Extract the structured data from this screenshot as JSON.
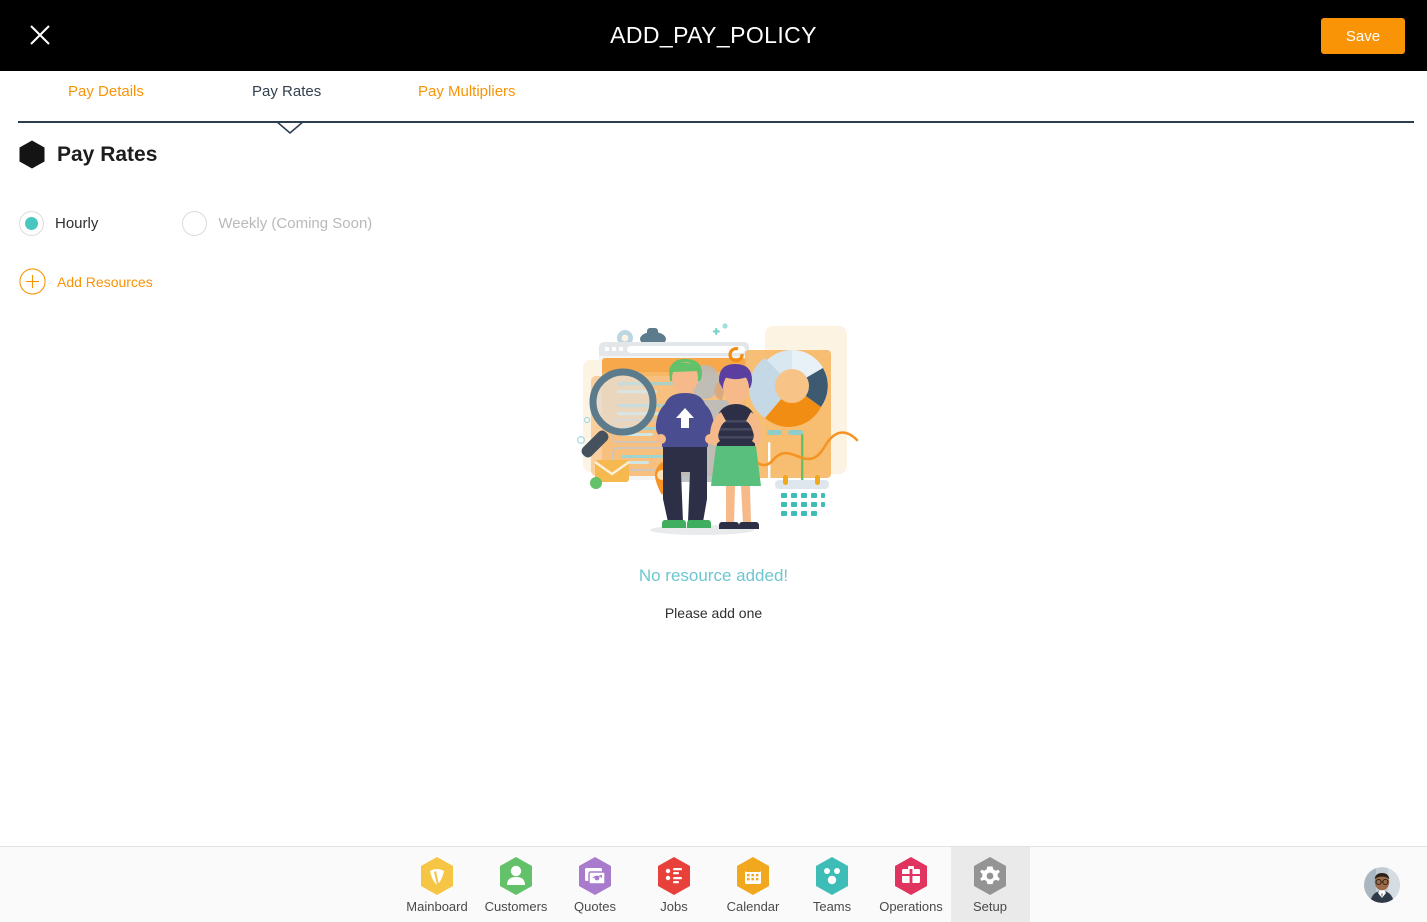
{
  "titlebar": {
    "title": "ADD_PAY_POLICY",
    "close_icon": "close-icon",
    "save_label": "Save",
    "save_color": "#f89406"
  },
  "tabs": [
    {
      "label": "Pay Details",
      "active": false
    },
    {
      "label": "Pay Rates",
      "active": true
    },
    {
      "label": "Pay Multipliers",
      "active": false
    }
  ],
  "section": {
    "title": "Pay Rates",
    "bullet_icon": "hexagon-icon"
  },
  "rate_type": {
    "selected": "Hourly",
    "options": [
      {
        "label": "Hourly",
        "selected": true,
        "disabled": false
      },
      {
        "label": "Weekly (Coming Soon)",
        "selected": false,
        "disabled": true
      }
    ],
    "selected_color": "#4ac6c0"
  },
  "add_resources": {
    "label": "Add Resources",
    "icon": "plus-circle-icon",
    "color": "#f89406"
  },
  "empty_state": {
    "illustration": "team-analytics-illustration",
    "title": "No resource added!",
    "title_color": "#6ec6cf",
    "subtitle": "Please add one"
  },
  "bottom_nav": {
    "items": [
      {
        "label": "Mainboard",
        "icon": "mainboard-icon",
        "color": "#f6c544",
        "active": false
      },
      {
        "label": "Customers",
        "icon": "person-icon",
        "color": "#63c16a",
        "active": false
      },
      {
        "label": "Quotes",
        "icon": "quotes-icon",
        "color": "#a97bcc",
        "active": false
      },
      {
        "label": "Jobs",
        "icon": "list-icon",
        "color": "#e8413c",
        "active": false
      },
      {
        "label": "Calendar",
        "icon": "calendar-icon",
        "color": "#f2a81d",
        "active": false
      },
      {
        "label": "Teams",
        "icon": "teams-icon",
        "color": "#3ebcb6",
        "active": false
      },
      {
        "label": "Operations",
        "icon": "briefcase-icon",
        "color": "#e0335f",
        "active": false
      },
      {
        "label": "Setup",
        "icon": "gear-icon",
        "color": "#949494",
        "active": true
      }
    ],
    "avatar": "user-avatar"
  }
}
